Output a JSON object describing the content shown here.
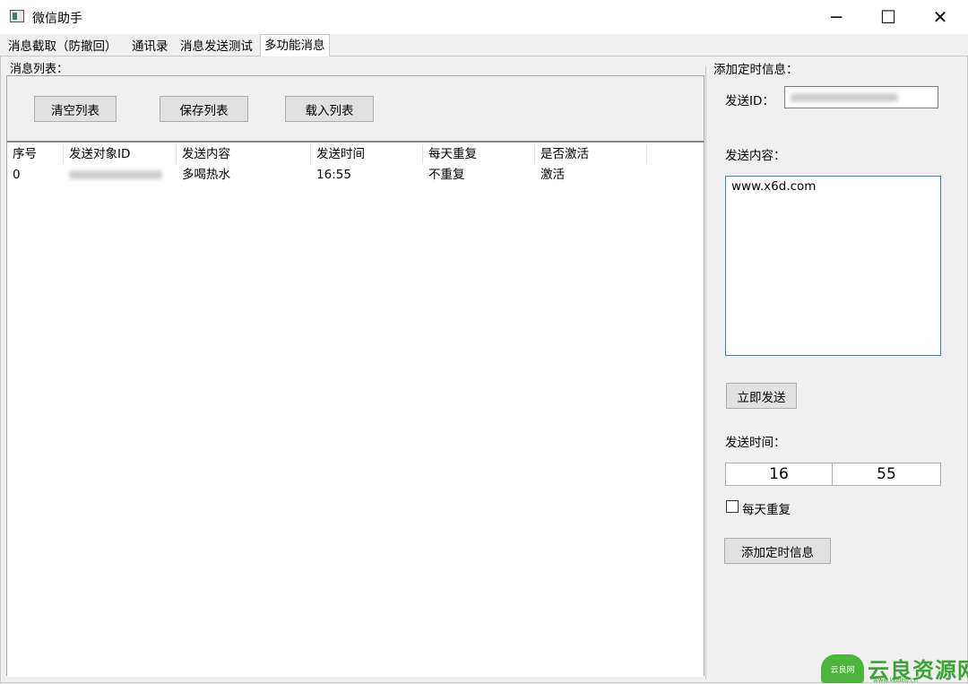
{
  "window": {
    "title": "微信助手",
    "minimize": "─",
    "maximize": "☐",
    "close": "✕"
  },
  "tabs": [
    {
      "label": "消息截取（防撤回）"
    },
    {
      "label": "通讯录"
    },
    {
      "label": "消息发送测试"
    },
    {
      "label": "多功能消息"
    }
  ],
  "left": {
    "group_title": "消息列表：",
    "buttons": {
      "clear": "清空列表",
      "save": "保存列表",
      "load": "载入列表"
    },
    "columns": [
      "序号",
      "发送对象ID",
      "发送内容",
      "发送时间",
      "每天重复",
      "是否激活"
    ],
    "rows": [
      {
        "index": "0",
        "target": "",
        "content": "多喝热水",
        "time": "16:55",
        "repeat": "不重复",
        "active": "激活"
      }
    ]
  },
  "right": {
    "group_title": "添加定时信息：",
    "send_id_label": "发送ID：",
    "send_id_value": "",
    "content_label": "发送内容：",
    "content_value": "www.x6d.com",
    "send_now": "立即发送",
    "time_label": "发送时间：",
    "hour": "16",
    "minute": "55",
    "repeat_label": "每天重复",
    "repeat_checked": false,
    "add_button": "添加定时信息"
  },
  "watermark": {
    "logo_text": "云良网",
    "brand": "云良资源网",
    "url": "www.kubbs.cn",
    "color": "#3ba534"
  }
}
